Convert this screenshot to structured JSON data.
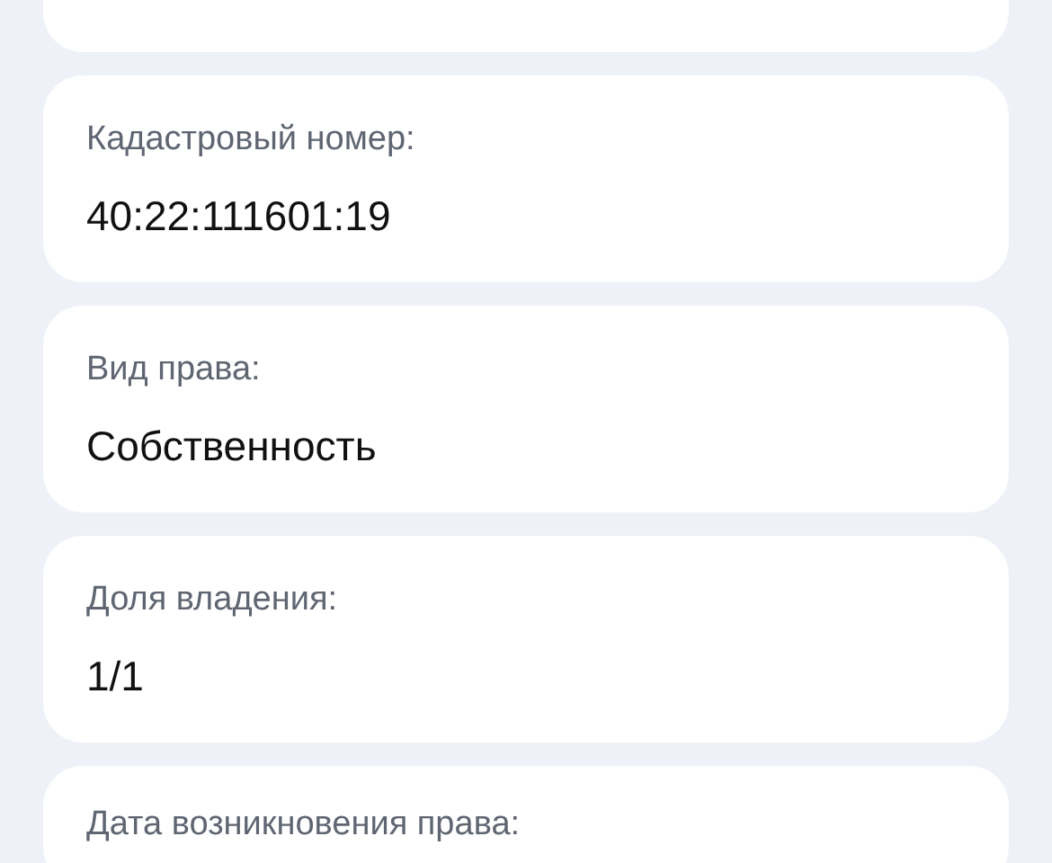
{
  "fields": [
    {
      "label": "Кадастровый номер:",
      "value": "40:22:111601:19"
    },
    {
      "label": "Вид права:",
      "value": "Собственность"
    },
    {
      "label": "Доля владения:",
      "value": "1/1"
    },
    {
      "label": "Дата возникновения права:"
    }
  ]
}
